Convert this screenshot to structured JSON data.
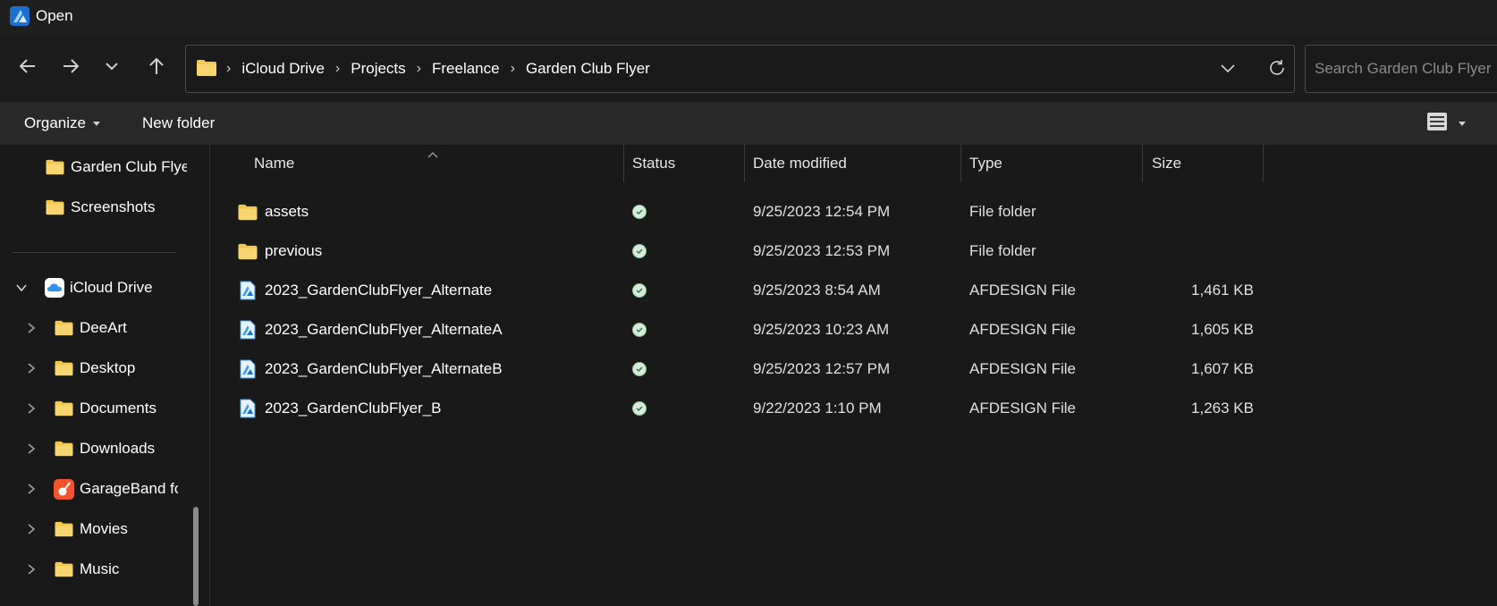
{
  "window": {
    "title": "Open"
  },
  "navigation": {
    "back_icon": "arrow-left-icon",
    "forward_icon": "arrow-right-icon",
    "recent_icon": "chevron-down-icon",
    "up_icon": "arrow-up-icon",
    "breadcrumbs": [
      "iCloud Drive",
      "Projects",
      "Freelance",
      "Garden Club Flyer"
    ],
    "search_placeholder": "Search Garden Club Flyer"
  },
  "toolbar": {
    "organize_label": "Organize",
    "new_folder_label": "New folder"
  },
  "sidebar": {
    "items": [
      {
        "label": "Garden Club Flyer",
        "icon": "folder-icon"
      },
      {
        "label": "Screenshots",
        "icon": "folder-icon"
      },
      {
        "label": "iCloud Drive",
        "icon": "icloud-icon",
        "expanded": true
      },
      {
        "label": "DeeArt",
        "icon": "folder-icon"
      },
      {
        "label": "Desktop",
        "icon": "folder-icon"
      },
      {
        "label": "Documents",
        "icon": "folder-icon"
      },
      {
        "label": "Downloads",
        "icon": "folder-icon"
      },
      {
        "label": "GarageBand for iOS",
        "icon": "garageband-icon"
      },
      {
        "label": "Movies",
        "icon": "folder-icon"
      },
      {
        "label": "Music",
        "icon": "folder-icon"
      }
    ]
  },
  "columns": {
    "name": "Name",
    "status": "Status",
    "date": "Date modified",
    "type": "Type",
    "size": "Size"
  },
  "files": [
    {
      "name": "assets",
      "icon": "folder-icon",
      "date": "9/25/2023 12:54 PM",
      "type": "File folder",
      "size": ""
    },
    {
      "name": "previous",
      "icon": "folder-icon",
      "date": "9/25/2023 12:53 PM",
      "type": "File folder",
      "size": ""
    },
    {
      "name": "2023_GardenClubFlyer_Alternate",
      "icon": "afdesign-icon",
      "date": "9/25/2023 8:54 AM",
      "type": "AFDESIGN File",
      "size": "1,461 KB"
    },
    {
      "name": "2023_GardenClubFlyer_AlternateA",
      "icon": "afdesign-icon",
      "date": "9/25/2023 10:23 AM",
      "type": "AFDESIGN File",
      "size": "1,605 KB"
    },
    {
      "name": "2023_GardenClubFlyer_AlternateB",
      "icon": "afdesign-icon",
      "date": "9/25/2023 12:57 PM",
      "type": "AFDESIGN File",
      "size": "1,607 KB"
    },
    {
      "name": "2023_GardenClubFlyer_B",
      "icon": "afdesign-icon",
      "date": "9/22/2023 1:10 PM",
      "type": "AFDESIGN File",
      "size": "1,263 KB"
    }
  ],
  "colors": {
    "background": "#191919",
    "toolbar": "#282828",
    "folder": "#f4c84a",
    "status_ok": "#8fc49a",
    "afdesign": "#3aa0e8"
  }
}
